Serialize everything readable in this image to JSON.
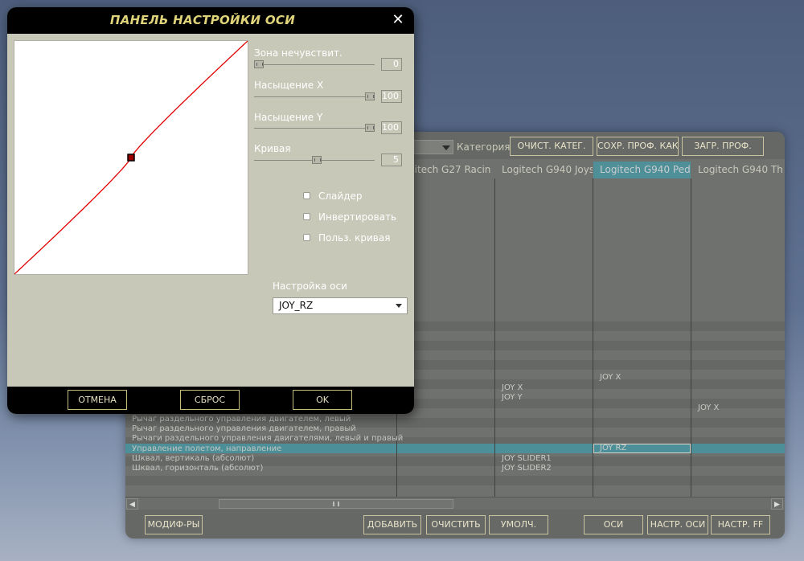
{
  "background_window": {
    "category_label": "Категория",
    "top_buttons": [
      "ОЧИСТ. КАТЕГ.",
      "СОХР. ПРОФ. КАК",
      "ЗАГР. ПРОФ."
    ],
    "columns": [
      "gitech G27 Racin",
      "Logitech G940 Joys",
      "Logitech G940 Ped",
      "Logitech G940 Th"
    ],
    "row_labels": [
      "Рычаг раздельного управления двигателем, левый",
      "Рычаг раздельного управления двигателем, правый",
      "Рычаги раздельного управления двигателями, левый и правый",
      "Управление полетом, направление",
      "Шквал, вертикаль (абсолют)",
      "Шквал, горизонталь (абсолют)"
    ],
    "cells": {
      "ped_joy_x": "JOY X",
      "joys_joy_x": "JOY X",
      "joys_joy_y": "JOY Y",
      "th_joy_x": "JOY X",
      "ped_joy_rz": "JOY RZ",
      "joys_slider1": "JOY SLIDER1",
      "joys_slider2": "JOY SLIDER2"
    },
    "bottom_buttons": [
      "МОДИФ-РЫ",
      "ДОБАВИТЬ",
      "ОЧИСТИТЬ",
      "УМОЛЧ.",
      "ОСИ",
      "НАСТР. ОСИ",
      "НАСТР. FF"
    ]
  },
  "axis_dialog": {
    "title": "ПАНЕЛЬ НАСТРОЙКИ ОСИ",
    "close_glyph": "✕",
    "sliders": [
      {
        "label": "Зона нечувствит.",
        "value": "0",
        "level": 0
      },
      {
        "label": "Насыщение X",
        "value": "100",
        "level": 100
      },
      {
        "label": "Насыщение Y",
        "value": "100",
        "level": 100
      },
      {
        "label": "Кривая",
        "value": "5",
        "level": 50
      }
    ],
    "checkboxes": [
      {
        "label": "Слайдер",
        "checked": false
      },
      {
        "label": "Инвертировать",
        "checked": false
      },
      {
        "label": "Польз. кривая",
        "checked": false
      }
    ],
    "axis_setup_label": "Настройка оси",
    "axis_setup_value": "JOY_RZ",
    "buttons": {
      "cancel": "ОТМЕНА",
      "reset": "СБРОС",
      "ok": "OK"
    },
    "colors": {
      "curve": "#e00000",
      "title": "#e0d47a"
    }
  }
}
